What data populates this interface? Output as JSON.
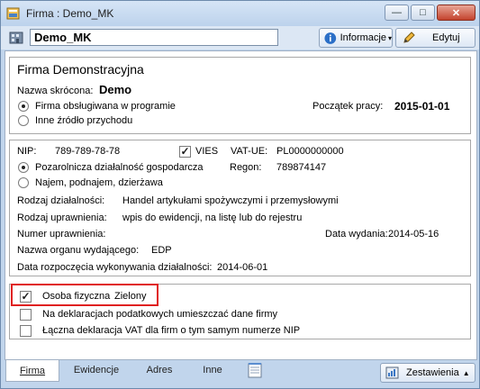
{
  "window": {
    "title": "Firma : Demo_MK",
    "controls": {
      "minimize": "—",
      "maximize": "□",
      "close": "✕"
    }
  },
  "toolbar": {
    "name_value": "Demo_MK",
    "info_label": "Informacje",
    "edit_label": "Edytuj"
  },
  "company": {
    "full_name": "Firma Demonstracyjna",
    "short_name_label": "Nazwa skrócona:",
    "short_name_value": "Demo",
    "radio_program": "Firma obsługiwana w programie",
    "radio_other": "Inne źródło przychodu",
    "start_label": "Początek pracy:",
    "start_value": "2015-01-01"
  },
  "tax": {
    "nip_label": "NIP:",
    "nip_value": "789-789-78-78",
    "vies_label": "VIES",
    "vatue_label": "VAT-UE:",
    "vatue_value": "PL0000000000",
    "radio_business": "Pozarolnicza działalność gospodarcza",
    "regon_label": "Regon:",
    "regon_value": "789874147",
    "radio_rental": "Najem, podnajem, dzierżawa",
    "activity_label": "Rodzaj działalności:",
    "activity_value": "Handel artykułami spożywczymi i przemysłowymi",
    "license_label": "Rodzaj uprawnienia:",
    "license_value": "wpis do ewidencji, na listę lub do rejestru",
    "license_number_label": "Numer uprawnienia:",
    "issue_date_label": "Data wydania:",
    "issue_date_value": "2014-05-16",
    "authority_label": "Nazwa organu wydającego:",
    "authority_value": "EDP",
    "activity_start_label": "Data rozpoczęcia wykonywania działalności:",
    "activity_start_value": "2014-06-01"
  },
  "options": {
    "natural_person_label": "Osoba fizyczna",
    "natural_person_name": "Zielony",
    "declarations_label": "Na deklaracjach podatkowych umieszczać dane firmy",
    "joint_vat_label": "Łączna deklaracja VAT dla firm o tym samym numerze NIP"
  },
  "tabs": {
    "firma": "Firma",
    "ewidencje": "Ewidencje",
    "adres": "Adres",
    "inne": "Inne",
    "zestawienia": "Zestawienia"
  }
}
